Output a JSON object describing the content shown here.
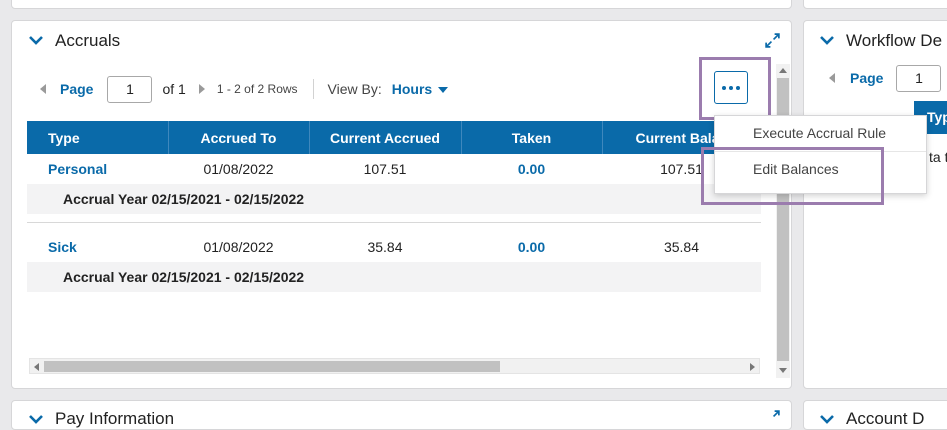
{
  "accruals": {
    "title": "Accruals",
    "pager": {
      "page_label": "Page",
      "page_value": "1",
      "of_label": "of 1",
      "rows_label": "1 - 2 of 2 Rows",
      "view_by_label": "View By:",
      "view_by_value": "Hours"
    },
    "columns": [
      "Type",
      "Accrued To",
      "Current Accrued",
      "Taken",
      "Current Balan"
    ],
    "rows": [
      {
        "type": "Personal",
        "accrued_to": "01/08/2022",
        "current_accrued": "107.51",
        "taken": "0.00",
        "current_balance": "107.51",
        "detail": "Accrual Year 02/15/2021 - 02/15/2022"
      },
      {
        "type": "Sick",
        "accrued_to": "01/08/2022",
        "current_accrued": "35.84",
        "taken": "0.00",
        "current_balance": "35.84",
        "detail": "Accrual Year 02/15/2021 - 02/15/2022"
      }
    ],
    "menu": {
      "items": [
        "Execute Accrual Rule",
        "Edit Balances"
      ]
    }
  },
  "workflow": {
    "title": "Workflow De",
    "page_label": "Page",
    "page_value": "1",
    "col_partial": "Type",
    "cell_partial": "ta t"
  },
  "bottom_left_title": "Pay Information",
  "bottom_right_title": "Account D",
  "colors": {
    "accent": "#0a6aa9",
    "highlight": "#9b7cae",
    "header_bg": "#0a6aa9"
  }
}
